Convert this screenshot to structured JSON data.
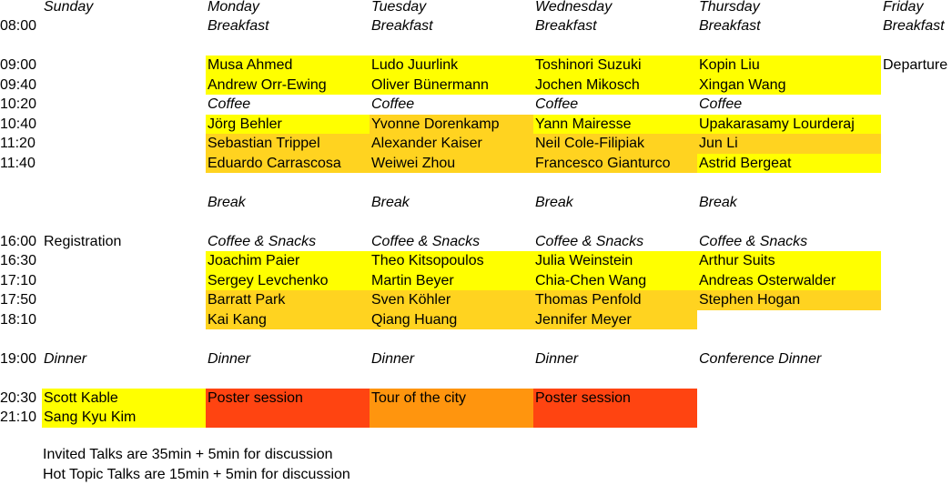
{
  "days": [
    "Sunday",
    "Monday",
    "Tuesday",
    "Wednesday",
    "Thursday",
    "Friday"
  ],
  "rows": [
    {
      "time": "08:00",
      "cells": [
        "",
        "Breakfast",
        "Breakfast",
        "Breakfast",
        "Breakfast",
        "Breakfast"
      ],
      "styles": [
        "",
        "it",
        "it",
        "it",
        "it",
        "it"
      ]
    },
    {
      "time": "",
      "cells": [
        "",
        "",
        "",
        "",
        "",
        ""
      ],
      "styles": [
        "",
        "",
        "",
        "",
        "",
        ""
      ]
    },
    {
      "time": "09:00",
      "cells": [
        "",
        "Musa Ahmed",
        "Ludo Juurlink",
        "Toshinori Suzuki",
        "Kopin Liu",
        "Departure"
      ],
      "styles": [
        "",
        "yellow",
        "yellow",
        "yellow",
        "yellow",
        ""
      ]
    },
    {
      "time": "09:40",
      "cells": [
        "",
        "Andrew Orr-Ewing",
        "Oliver Bünermann",
        "Jochen Mikosch",
        "Xingan Wang",
        ""
      ],
      "styles": [
        "",
        "yellow",
        "yellow",
        "yellow",
        "yellow",
        ""
      ]
    },
    {
      "time": "10:20",
      "cells": [
        "",
        "Coffee",
        "Coffee",
        "Coffee",
        "Coffee",
        ""
      ],
      "styles": [
        "",
        "it",
        "it",
        "it",
        "it",
        ""
      ]
    },
    {
      "time": "10:40",
      "cells": [
        "",
        "Jörg Behler",
        "Yvonne Dorenkamp",
        "Yann Mairesse",
        "Upakarasamy Lourderaj",
        ""
      ],
      "styles": [
        "",
        "yellow",
        "amber",
        "yellow",
        "yellow",
        ""
      ]
    },
    {
      "time": "11:20",
      "cells": [
        "",
        "Sebastian Trippel",
        "Alexander Kaiser",
        "Neil Cole-Filipiak",
        "Jun Li",
        ""
      ],
      "styles": [
        "",
        "amber",
        "amber",
        "amber",
        "amber",
        ""
      ]
    },
    {
      "time": "11:40",
      "cells": [
        "",
        "Eduardo Carrascosa",
        "Weiwei Zhou",
        "Francesco Gianturco",
        "Astrid Bergeat",
        ""
      ],
      "styles": [
        "",
        "amber",
        "amber",
        "amber",
        "yellow",
        ""
      ]
    },
    {
      "time": "",
      "cells": [
        "",
        "",
        "",
        "",
        "",
        ""
      ],
      "styles": [
        "",
        "",
        "",
        "",
        "",
        ""
      ]
    },
    {
      "time": "",
      "cells": [
        "",
        "Break",
        "Break",
        "Break",
        "Break",
        ""
      ],
      "styles": [
        "",
        "it",
        "it",
        "it",
        "it",
        ""
      ]
    },
    {
      "time": "",
      "cells": [
        "",
        "",
        "",
        "",
        "",
        ""
      ],
      "styles": [
        "",
        "",
        "",
        "",
        "",
        ""
      ]
    },
    {
      "time": "16:00",
      "cells": [
        "Registration",
        "Coffee & Snacks",
        "Coffee & Snacks",
        "Coffee & Snacks",
        "Coffee & Snacks",
        ""
      ],
      "styles": [
        "",
        "it",
        "it",
        "it",
        "it",
        ""
      ]
    },
    {
      "time": "16:30",
      "cells": [
        "",
        "Joachim Paier",
        "Theo Kitsopoulos",
        "Julia Weinstein",
        "Arthur Suits",
        ""
      ],
      "styles": [
        "",
        "yellow",
        "yellow",
        "yellow",
        "yellow",
        ""
      ]
    },
    {
      "time": "17:10",
      "cells": [
        "",
        "Sergey Levchenko",
        "Martin Beyer",
        "Chia-Chen Wang",
        "Andreas Osterwalder",
        ""
      ],
      "styles": [
        "",
        "yellow",
        "yellow",
        "yellow",
        "yellow",
        ""
      ]
    },
    {
      "time": "17:50",
      "cells": [
        "",
        "Barratt Park",
        "Sven Köhler",
        "Thomas Penfold",
        "Stephen Hogan",
        ""
      ],
      "styles": [
        "",
        "amber",
        "amber",
        "amber",
        "amber",
        ""
      ]
    },
    {
      "time": "18:10",
      "cells": [
        "",
        "Kai Kang",
        "Qiang Huang",
        "Jennifer Meyer",
        "",
        ""
      ],
      "styles": [
        "",
        "amber",
        "amber",
        "amber",
        "",
        ""
      ]
    },
    {
      "time": "",
      "cells": [
        "",
        "",
        "",
        "",
        "",
        ""
      ],
      "styles": [
        "",
        "",
        "",
        "",
        "",
        ""
      ]
    },
    {
      "time": "19:00",
      "cells": [
        "Dinner",
        "Dinner",
        "Dinner",
        "Dinner",
        "Conference Dinner",
        ""
      ],
      "styles": [
        "it",
        "it",
        "it",
        "it",
        "it",
        ""
      ]
    },
    {
      "time": "",
      "cells": [
        "",
        "",
        "",
        "",
        "",
        ""
      ],
      "styles": [
        "",
        "",
        "",
        "",
        "",
        ""
      ]
    },
    {
      "time": "20:30",
      "cells": [
        "Scott Kable",
        "Poster session",
        "Tour of the city",
        "Poster session",
        "",
        ""
      ],
      "styles": [
        "yellow",
        "red",
        "orange",
        "red",
        "",
        ""
      ]
    },
    {
      "time": "21:10",
      "cells": [
        "Sang Kyu Kim",
        "",
        "",
        "",
        "",
        ""
      ],
      "styles": [
        "yellow",
        "red",
        "orange",
        "red",
        "",
        ""
      ]
    }
  ],
  "notes": [
    "Invited Talks are 35min + 5min for discussion",
    "Hot Topic Talks are 15min + 5min for discussion"
  ],
  "colors": {
    "invited_talk": "#ffff00",
    "hot_topic_talk": "#ffd320",
    "poster_session": "#ff4411",
    "tour": "#ff950e"
  }
}
